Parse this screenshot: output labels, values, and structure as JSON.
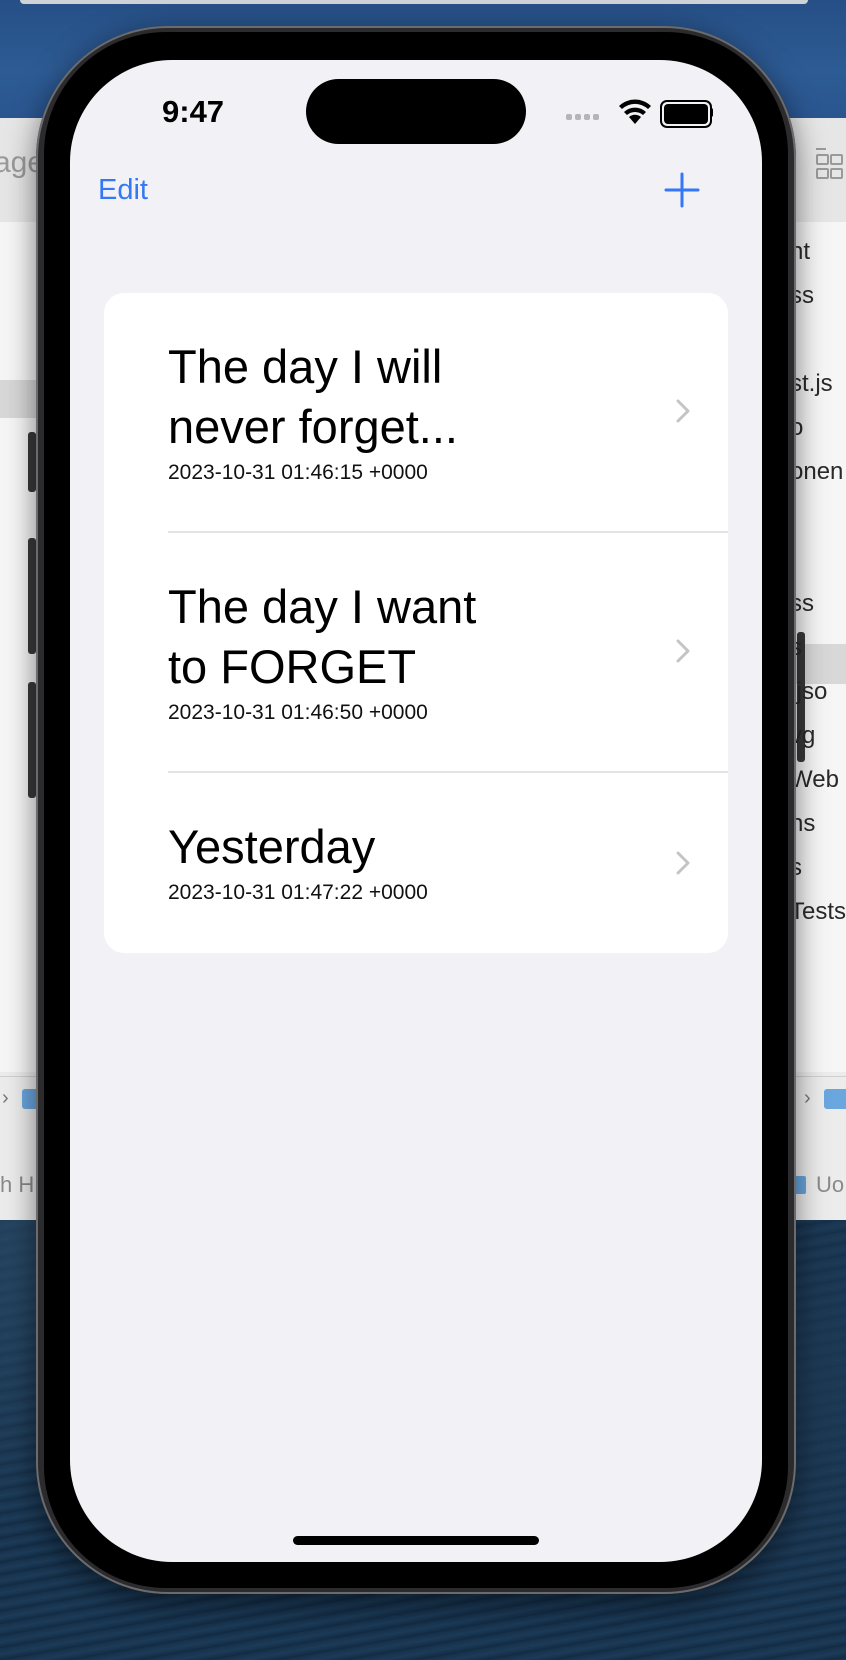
{
  "status_bar": {
    "time": "9:47"
  },
  "nav": {
    "edit_label": "Edit",
    "add_icon": "plus-icon"
  },
  "entries": [
    {
      "title": "The day I will\nnever forget...",
      "date": "2023-10-31 01:46:15 +0000"
    },
    {
      "title": "The day I want\nto FORGET",
      "date": "2023-10-31 01:46:50 +0000"
    },
    {
      "title": "Yesterday",
      "date": "2023-10-31 01:47:22 +0000"
    }
  ],
  "background": {
    "finder_left_title": "age",
    "finder_right_items": [
      "nt",
      "ss",
      "st.js",
      "o",
      "onen",
      "ss",
      "s",
      ".jso",
      "vg",
      "Web",
      "ns",
      "s",
      "Tests"
    ],
    "status_left": "h HI",
    "status_right": "Uo"
  },
  "colors": {
    "accent": "#3478f6",
    "screen_background": "#f1f1f6",
    "card_background": "#ffffff"
  }
}
